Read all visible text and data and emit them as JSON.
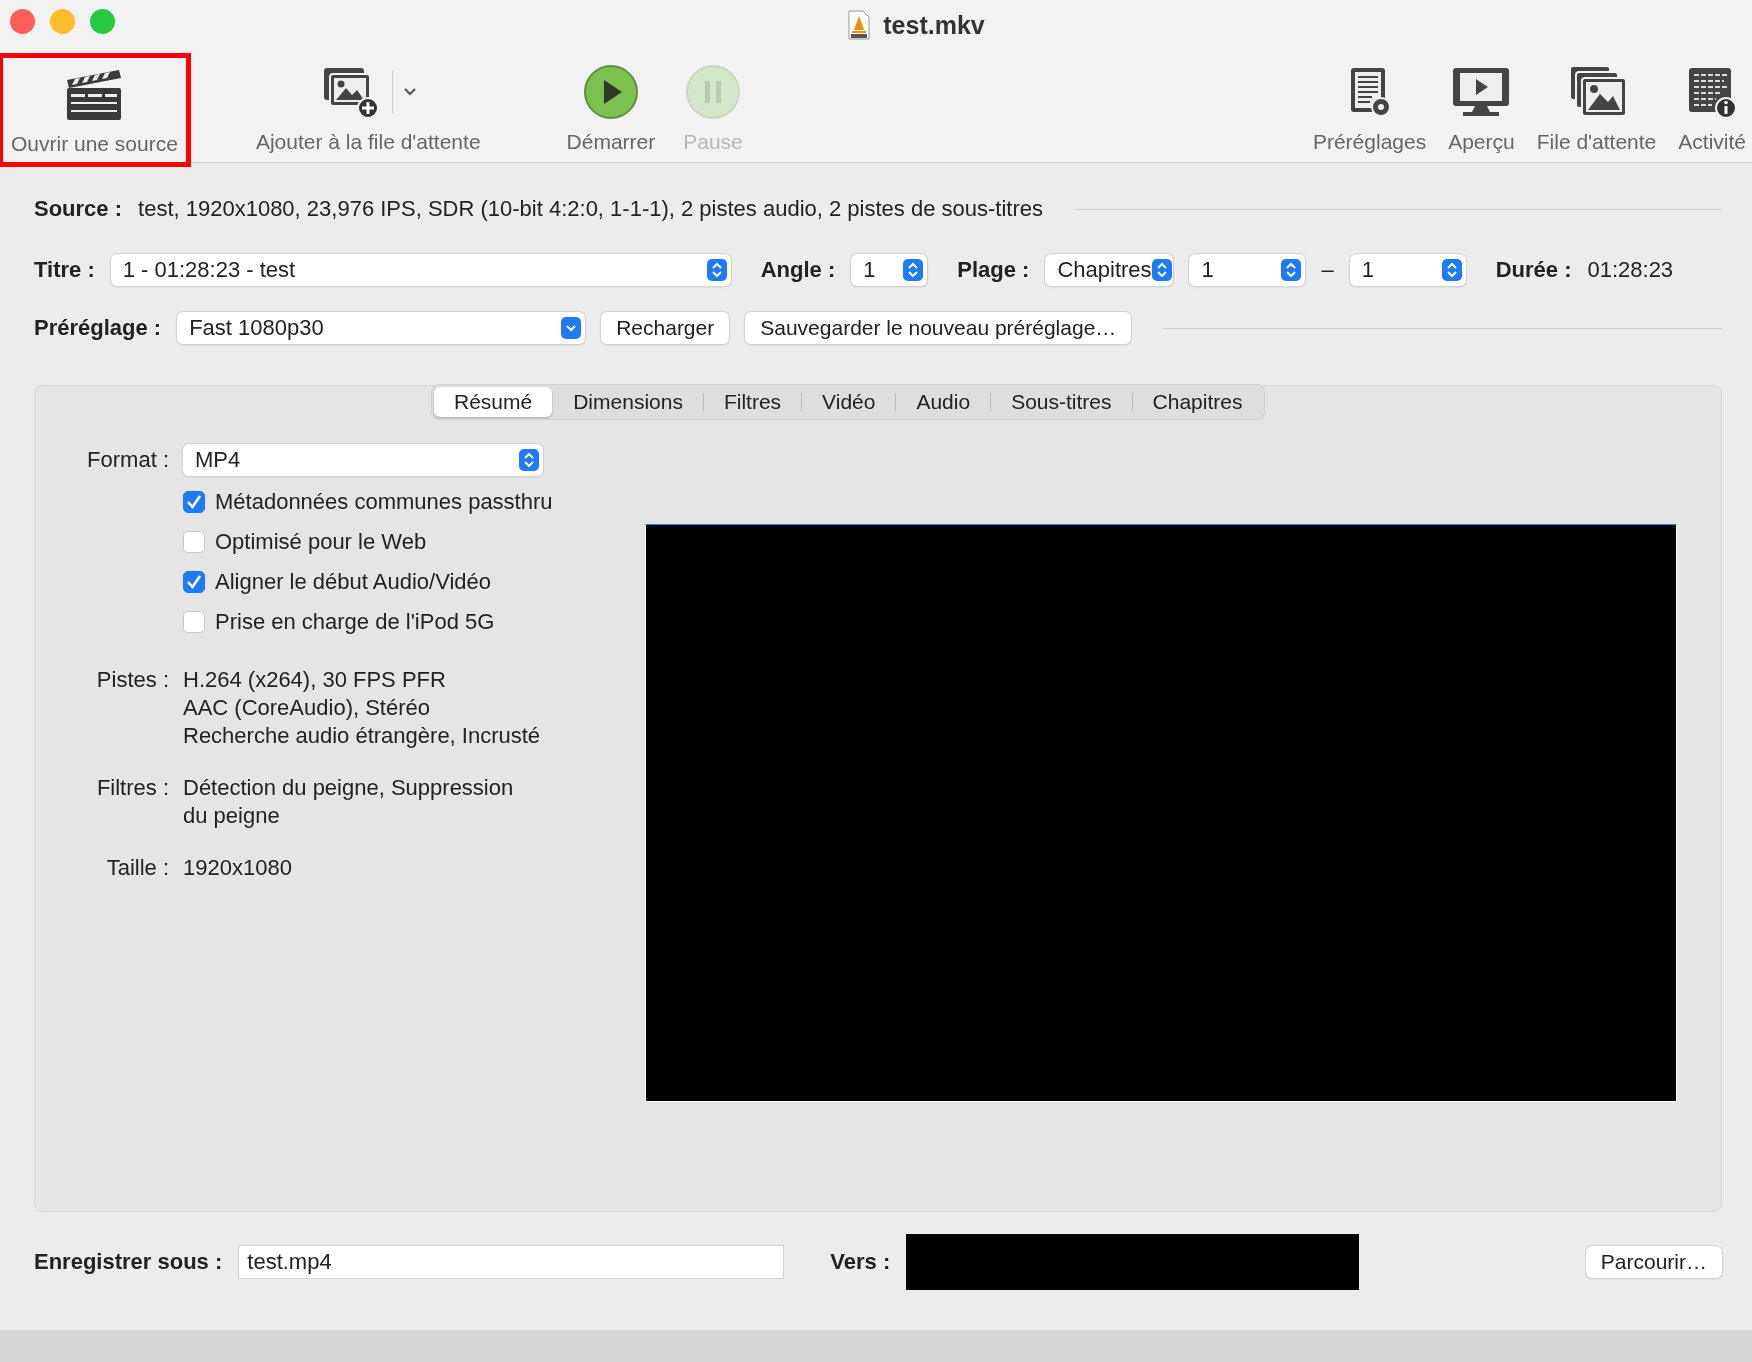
{
  "window": {
    "title": "test.mkv"
  },
  "toolbar": {
    "items": [
      {
        "kind": "open",
        "label": "Ouvrir une source",
        "disabled": false,
        "highlighted": true
      },
      {
        "kind": "add",
        "label": "Ajouter à la file d'attente",
        "disabled": false,
        "highlighted": false
      },
      {
        "kind": "start",
        "label": "Démarrer",
        "disabled": false,
        "highlighted": false
      },
      {
        "kind": "pause",
        "label": "Pause",
        "disabled": true,
        "highlighted": false
      },
      {
        "kind": "presets",
        "label": "Préréglages",
        "disabled": false,
        "highlighted": false
      },
      {
        "kind": "preview",
        "label": "Aperçu",
        "disabled": false,
        "highlighted": false
      },
      {
        "kind": "queue",
        "label": "File d'attente",
        "disabled": false,
        "highlighted": false
      },
      {
        "kind": "activity",
        "label": "Activité",
        "disabled": false,
        "highlighted": false
      }
    ]
  },
  "source": {
    "label": "Source :",
    "value": "test, 1920x1080, 23,976 IPS, SDR (10-bit 4:2:0, 1-1-1), 2 pistes audio, 2 pistes de sous-titres"
  },
  "title_row": {
    "label": "Titre :",
    "title": "1 - 01:28:23 - test",
    "angle_label": "Angle :",
    "angle": "1",
    "range_label": "Plage :",
    "range_type": "Chapitres",
    "range_start": "1",
    "range_separator": "–",
    "range_end": "1",
    "duration_label": "Durée :",
    "duration": "01:28:23"
  },
  "preset_row": {
    "label": "Préréglage :",
    "preset": "Fast 1080p30",
    "buttons": [
      "Recharger",
      "Sauvegarder le nouveau préréglage…"
    ]
  },
  "tabs": [
    {
      "label": "Résumé",
      "selected": true
    },
    {
      "label": "Dimensions",
      "selected": false
    },
    {
      "label": "Filtres",
      "selected": false
    },
    {
      "label": "Vidéo",
      "selected": false
    },
    {
      "label": "Audio",
      "selected": false
    },
    {
      "label": "Sous-titres",
      "selected": false
    },
    {
      "label": "Chapitres",
      "selected": false
    }
  ],
  "summary": {
    "format_label": "Format :",
    "format": "MP4",
    "options": [
      {
        "label": "Métadonnées communes passthru",
        "checked": true
      },
      {
        "label": "Optimisé pour le Web",
        "checked": false
      },
      {
        "label": "Aligner le début Audio/Vidéo",
        "checked": true
      },
      {
        "label": "Prise en charge de l'iPod 5G",
        "checked": false
      }
    ],
    "details": [
      {
        "label": "Pistes :",
        "lines": [
          "H.264 (x264), 30 FPS PFR",
          "AAC (CoreAudio), Stéréo",
          "Recherche audio étrangère, Incrusté"
        ]
      },
      {
        "label": "Filtres :",
        "lines": [
          "Détection du peigne, Suppression",
          "du peigne"
        ]
      },
      {
        "label": "Taille :",
        "lines": [
          "1920x1080"
        ]
      }
    ]
  },
  "save_row": {
    "label": "Enregistrer sous :",
    "filename": "test.mp4",
    "destination_label": "Vers :",
    "browse": "Parcourir…"
  }
}
